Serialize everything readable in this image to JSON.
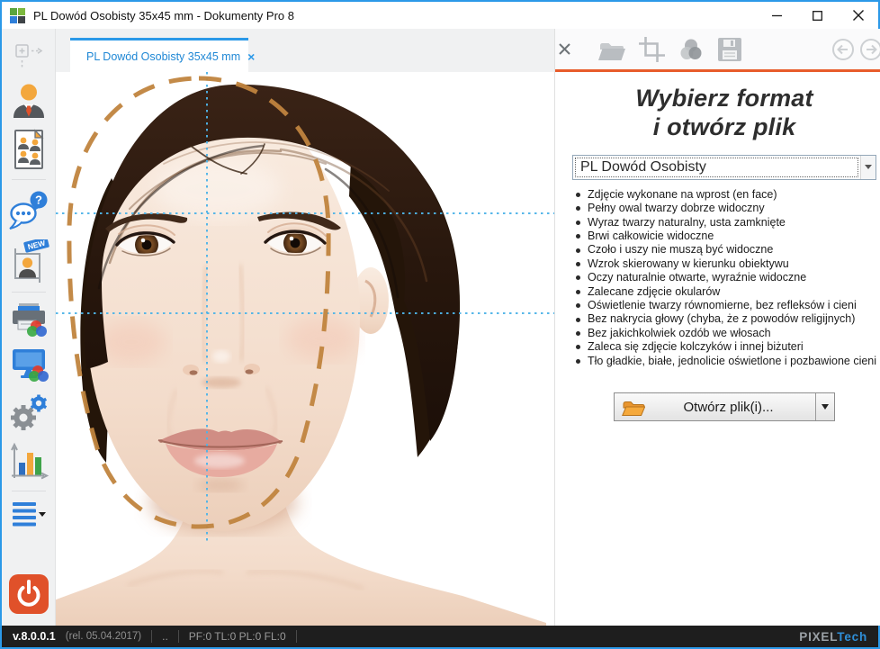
{
  "window": {
    "title": "PL Dowód Osobisty 35x45 mm - Dokumenty Pro 8"
  },
  "tab": {
    "label": "PL Dowód Osobisty  35x45 mm",
    "close": "×"
  },
  "sidebar": {
    "items": [
      {
        "name": "move-placeholder-icon"
      },
      {
        "name": "single-person-icon"
      },
      {
        "name": "people-document-icon"
      },
      {
        "name": "help-chat-icon"
      },
      {
        "name": "new-crop-person-icon",
        "badge": "NEW"
      },
      {
        "name": "print-colors-icon"
      },
      {
        "name": "display-colors-icon"
      },
      {
        "name": "settings-gears-icon"
      },
      {
        "name": "statistics-chart-icon"
      },
      {
        "name": "menu-list-icon"
      },
      {
        "name": "power-icon"
      }
    ]
  },
  "toolbar": {
    "icons": [
      "close-icon",
      "open-folder-icon",
      "crop-icon",
      "colors-icon",
      "save-icon",
      "back-icon",
      "forward-icon"
    ]
  },
  "right_panel": {
    "heading_line1": "Wybierz format",
    "heading_line2": "i otwórz plik",
    "format_select": {
      "value": "PL Dowód Osobisty"
    },
    "requirements": [
      "Zdjęcie wykonane na wprost (en face)",
      "Pełny owal twarzy dobrze widoczny",
      "Wyraz twarzy naturalny, usta zamknięte",
      "Brwi całkowicie widoczne",
      "Czoło i uszy nie muszą być widoczne",
      "Wzrok skierowany w kierunku obiektywu",
      "Oczy naturalnie otwarte, wyraźnie widoczne",
      "Zalecane zdjęcie okularów",
      "Oświetlenie twarzy równomierne, bez refleksów i cieni",
      "Bez nakrycia głowy (chyba, że z powodów religijnych)",
      "Bez jakichkolwiek ozdób we włosach",
      "Zaleca się zdjęcie kolczyków i innej biżuteri",
      "Tło gładkie, białe, jednolicie oświetlone i pozbawione cieni"
    ],
    "open_button": {
      "label": "Otwórz plik(i)..."
    }
  },
  "status_bar": {
    "version": "v.8.0.0.1",
    "release": "(rel. 05.04.2017)",
    "dots": "..",
    "counters": "PF:0 TL:0 PL:0 FL:0",
    "brand_gray": "PIXEL",
    "brand_blue": "Tech"
  },
  "colors": {
    "accent_blue": "#2b99e8",
    "accent_orange": "#e85c2b",
    "guide_oval_orange": "#c0843e",
    "guide_line_cyan": "#4fb4e8",
    "power_red": "#e0512a",
    "statusbar_bg": "#1e1e1e"
  }
}
